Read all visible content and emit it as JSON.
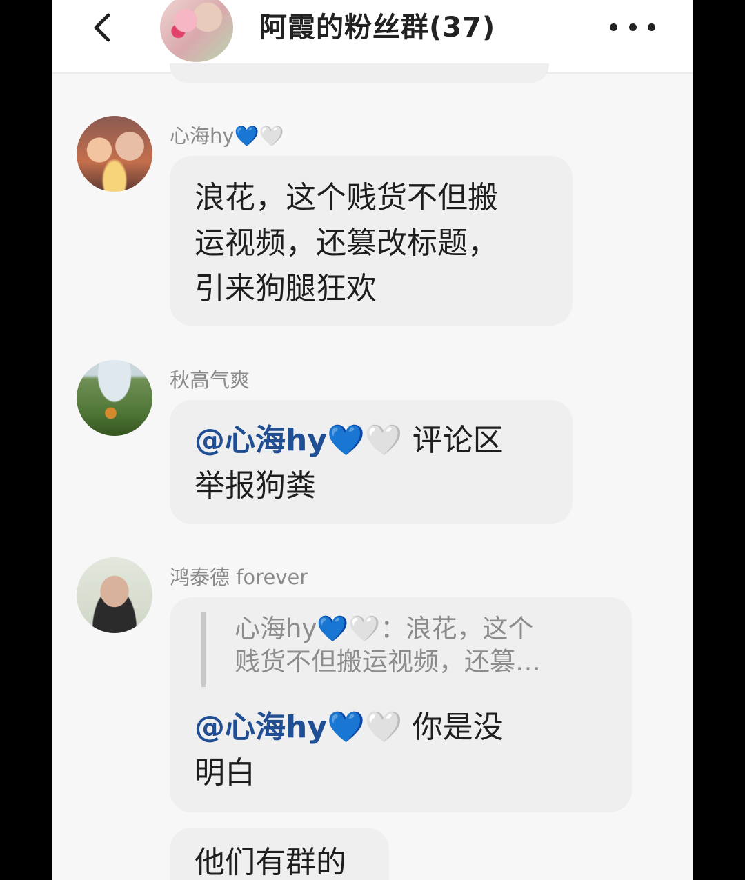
{
  "header": {
    "title": "阿霞的粉丝群(37)",
    "back_icon": "chevron-left-icon",
    "more_icon": "more-horizontal-icon"
  },
  "messages": [
    {
      "sender": "心海hy💙🤍",
      "text_lines": [
        "浪花，这个贱货不但搬",
        "运视频，还篡改标题，",
        "引来狗腿狂欢"
      ]
    },
    {
      "sender": "秋高气爽",
      "mention": "@心海hy💙🤍",
      "text_lines": [
        "评论区",
        "举报狗粪"
      ]
    },
    {
      "sender": "鸿泰德 forever",
      "quote_lines": [
        "心海hy💙🤍：浪花，这个",
        "贱货不但搬运视频，还篡…"
      ],
      "mention": "@心海hy💙🤍",
      "text_lines": [
        "你是没",
        "明白"
      ]
    },
    {
      "text": "他们有群的"
    }
  ],
  "colors": {
    "mention": "#1f4e93",
    "bubble": "#efefef",
    "background": "#f7f7f7",
    "name": "#8a8a8a"
  }
}
